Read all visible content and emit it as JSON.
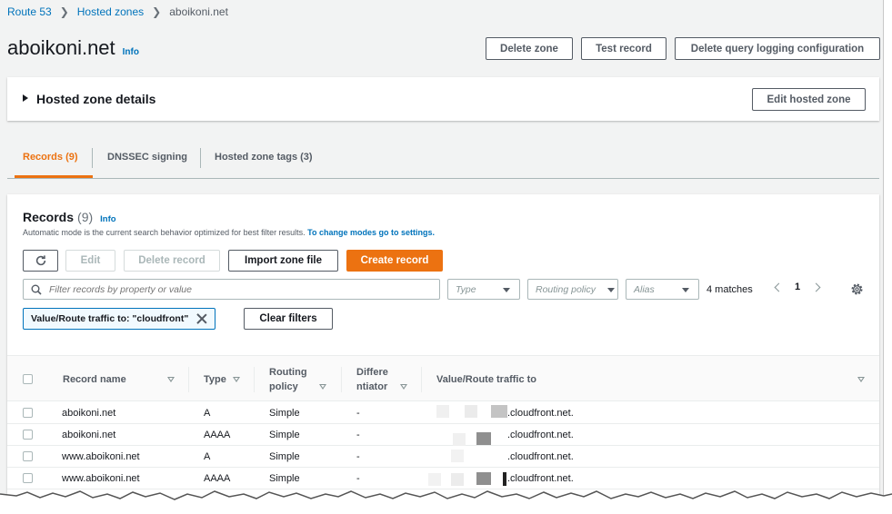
{
  "breadcrumb": {
    "items": [
      "Route 53",
      "Hosted zones"
    ],
    "current": "aboikoni.net"
  },
  "header": {
    "title": "aboikoni.net",
    "info": "Info",
    "buttons": {
      "delete_zone": "Delete zone",
      "test_record": "Test record",
      "delete_query_logging": "Delete query logging configuration"
    }
  },
  "details_panel": {
    "label": "Hosted zone details",
    "edit_button": "Edit hosted zone"
  },
  "tabs": [
    {
      "label": "Records (9)",
      "active": true
    },
    {
      "label": "DNSSEC signing",
      "active": false
    },
    {
      "label": "Hosted zone tags (3)",
      "active": false
    }
  ],
  "records": {
    "title": "Records",
    "count": "(9)",
    "info": "Info",
    "description": "Automatic mode is the current search behavior optimized for best filter results.",
    "description_link": "To change modes go to settings.",
    "toolbar": {
      "refresh_icon": "refresh-icon",
      "edit": "Edit",
      "delete_record": "Delete record",
      "import_zone_file": "Import zone file",
      "create_record": "Create record"
    },
    "filter": {
      "placeholder": "Filter records by property or value",
      "type_placeholder": "Type",
      "routing_placeholder": "Routing policy",
      "alias_placeholder": "Alias",
      "matches": "4 matches",
      "page": "1"
    },
    "active_filter": "Value/Route traffic to: \"cloudfront\"",
    "clear_filters": "Clear filters",
    "columns": {
      "record_name": "Record name",
      "type": "Type",
      "routing_line1": "Routing",
      "routing_line2": "policy",
      "diff_line1": "Differe",
      "diff_line2": "ntiator",
      "value": "Value/Route traffic to"
    },
    "rows": [
      {
        "name": "aboikoni.net",
        "type": "A",
        "routing": "Simple",
        "differentiator": "-",
        "value": ".cloudfront.net."
      },
      {
        "name": "aboikoni.net",
        "type": "AAAA",
        "routing": "Simple",
        "differentiator": "-",
        "value": ".cloudfront.net."
      },
      {
        "name": "www.aboikoni.net",
        "type": "A",
        "routing": "Simple",
        "differentiator": "-",
        "value": ".cloudfront.net."
      },
      {
        "name": "www.aboikoni.net",
        "type": "AAAA",
        "routing": "Simple",
        "differentiator": "-",
        "value": ".cloudfront.net."
      }
    ]
  },
  "colors": {
    "accent": "#ec7211",
    "link": "#0073bb",
    "background": "#f2f3f3"
  }
}
